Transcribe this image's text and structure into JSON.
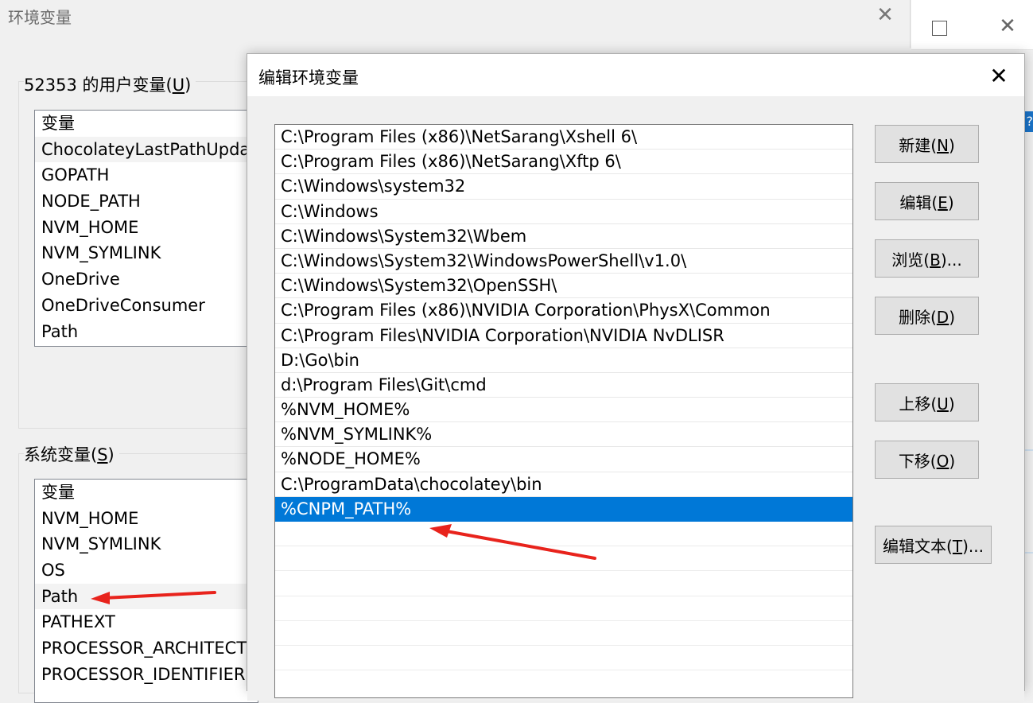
{
  "background_window": {
    "title": "环境变量",
    "close_glyph": "✕",
    "user_section": {
      "label_prefix": "52353 的用户变量(",
      "label_key": "U",
      "label_suffix": ")",
      "header": "变量",
      "items": [
        "ChocolateyLastPathUpda",
        "GOPATH",
        "NODE_PATH",
        "NVM_HOME",
        "NVM_SYMLINK",
        "OneDrive",
        "OneDriveConsumer",
        "Path"
      ]
    },
    "system_section": {
      "label_prefix": "系统变量(",
      "label_key": "S",
      "label_suffix": ")",
      "header": "变量",
      "items": [
        "NVM_HOME",
        "NVM_SYMLINK",
        "OS",
        "Path",
        "PATHEXT",
        "PROCESSOR_ARCHITECT",
        "PROCESSOR_IDENTIFIER"
      ]
    }
  },
  "third_window": {
    "maximize_glyph": "□",
    "close_glyph": "✕",
    "help_glyph": "?"
  },
  "edit_dialog": {
    "title": "编辑环境变量",
    "close_glyph": "✕",
    "paths": [
      "C:\\Program Files (x86)\\NetSarang\\Xshell 6\\",
      "C:\\Program Files (x86)\\NetSarang\\Xftp 6\\",
      "C:\\Windows\\system32",
      "C:\\Windows",
      "C:\\Windows\\System32\\Wbem",
      "C:\\Windows\\System32\\WindowsPowerShell\\v1.0\\",
      "C:\\Windows\\System32\\OpenSSH\\",
      "C:\\Program Files (x86)\\NVIDIA Corporation\\PhysX\\Common",
      "C:\\Program Files\\NVIDIA Corporation\\NVIDIA NvDLISR",
      "D:\\Go\\bin",
      "d:\\Program Files\\Git\\cmd",
      "%NVM_HOME%",
      "%NVM_SYMLINK%",
      "%NODE_HOME%",
      "C:\\ProgramData\\chocolatey\\bin",
      "%CNPM_PATH%"
    ],
    "selected_index": 15,
    "buttons": {
      "new": {
        "pre": "新建(",
        "key": "N",
        "post": ")"
      },
      "edit": {
        "pre": "编辑(",
        "key": "E",
        "post": ")"
      },
      "browse": {
        "pre": "浏览(",
        "key": "B",
        "post": ")..."
      },
      "delete": {
        "pre": "删除(",
        "key": "D",
        "post": ")"
      },
      "up": {
        "pre": "上移(",
        "key": "U",
        "post": ")"
      },
      "down": {
        "pre": "下移(",
        "key": "O",
        "post": ")"
      },
      "edit_text": {
        "pre": "编辑文本(",
        "key": "T",
        "post": ")..."
      }
    }
  },
  "colors": {
    "selection": "#0078d7",
    "annotation_arrow": "#e8231c"
  }
}
